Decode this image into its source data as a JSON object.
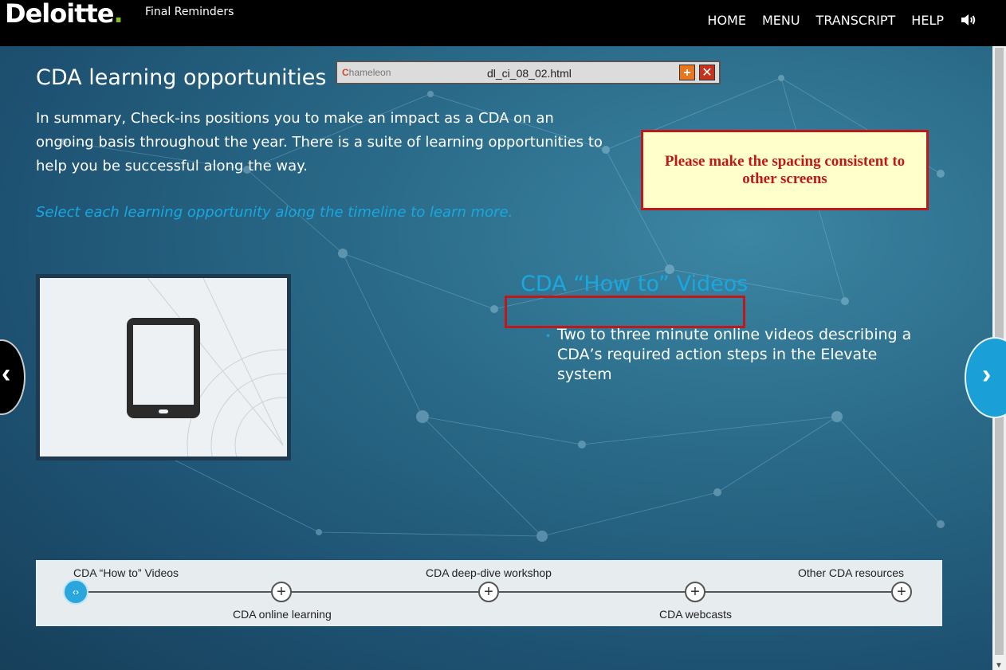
{
  "header": {
    "brand": "Deloitte",
    "brand_dot": ".",
    "course_title": "Final Reminders",
    "nav": [
      {
        "label": "HOME"
      },
      {
        "label": "MENU"
      },
      {
        "label": "TRANSCRIPT"
      },
      {
        "label": "HELP"
      }
    ],
    "audio_icon": "speaker-icon"
  },
  "popup": {
    "brand_initial": "C",
    "brand_rest": "hameleon",
    "filename": "dl_ci_08_02.html",
    "plus_glyph": "+",
    "close_glyph": "✕"
  },
  "main": {
    "title": "CDA learning opportunities",
    "summary": "In summary, Check-ins positions you to make an impact as a CDA on an ongoing basis throughout the year. There is a suite of learning opportunities to help you be successful along the way.",
    "instruction": "Select each learning opportunity along the timeline to learn more.",
    "detail_title": "CDA “How to” Videos",
    "detail_bullet": "Two to three minute online videos describing a CDA’s required action steps in the Elevate system",
    "image_icon": "tablet-icon"
  },
  "review_note": {
    "text": "Please make the spacing consistent to other screens"
  },
  "timeline": {
    "items": [
      {
        "label": "CDA “How to” Videos",
        "active": true
      },
      {
        "label": "CDA online learning",
        "active": false
      },
      {
        "label": "CDA deep-dive workshop",
        "active": false
      },
      {
        "label": "CDA webcasts",
        "active": false
      },
      {
        "label": "Other CDA resources",
        "active": false
      }
    ],
    "node_plus": "+",
    "active_glyph": "‹›"
  },
  "side_nav": {
    "prev_glyph": "‹",
    "next_glyph": "›"
  },
  "colors": {
    "accent": "#19a7e0",
    "brand_green": "#86bc25",
    "note_red": "#c01818",
    "note_bg": "#ffffcc"
  }
}
